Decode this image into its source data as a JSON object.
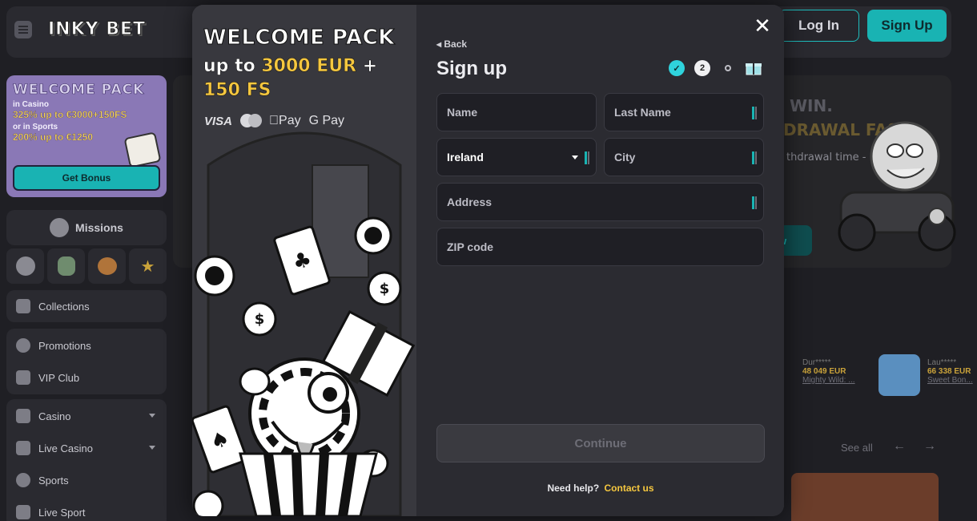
{
  "header": {
    "logo_text": "INKY BET",
    "login_label": "Log In",
    "signup_label": "Sign Up"
  },
  "sidebar": {
    "promo": {
      "title": "WELCOME PACK",
      "casino_label": "in Casino",
      "casino_offer": "325% up to €3000+150FS",
      "sports_label": "or in Sports",
      "sports_offer": "200% up to €1250",
      "button": "Get Bonus"
    },
    "missions_label": "Missions",
    "items": [
      {
        "label": "Collections",
        "icon": "bookmark-icon"
      },
      {
        "label": "Promotions",
        "icon": "percent-icon"
      },
      {
        "label": "VIP Club",
        "icon": "crown-icon"
      },
      {
        "label": "Casino",
        "icon": "casino-chip-icon"
      },
      {
        "label": "Live Casino",
        "icon": "dice-icon"
      },
      {
        "label": "Sports",
        "icon": "ball-icon"
      },
      {
        "label": "Live Sport",
        "icon": "camera-icon"
      }
    ]
  },
  "background": {
    "banner_line1": "WIN.",
    "banner_line2": "DRAWAL FAST",
    "banner_text": "thdrawal time -",
    "cta_fragment": "ow",
    "winners": [
      {
        "user": "Dur*****",
        "amount": "48 049 EUR",
        "game": "Mighty Wild: ..."
      },
      {
        "user": "Lau*****",
        "amount": "66 338 EUR",
        "game": "Sweet Bon..."
      }
    ],
    "see_all": "See all"
  },
  "modal": {
    "left": {
      "title": "WELCOME PACK",
      "subtitle_prefix": "up to",
      "subtitle_amount": "3000 EUR",
      "subtitle_plus": "+",
      "subtitle_fs": "150 FS",
      "payments": {
        "visa": "VISA",
        "mastercard": "mobilecard",
        "apple": "Pay",
        "google": "G Pay"
      }
    },
    "back_label": "Back",
    "title": "Sign up",
    "steps": {
      "current": "2"
    },
    "fields": {
      "name": {
        "placeholder": "Name",
        "value": ""
      },
      "last_name": {
        "placeholder": "Last Name",
        "value": ""
      },
      "country": {
        "value": "Ireland"
      },
      "city": {
        "placeholder": "City",
        "value": ""
      },
      "address": {
        "placeholder": "Address",
        "value": ""
      },
      "zip": {
        "placeholder": "ZIP code",
        "value": ""
      }
    },
    "continue_label": "Continue",
    "help_text": "Need help?",
    "contact_label": "Contact us"
  },
  "colors": {
    "accent": "#19b3b3",
    "highlight": "#f5c73f",
    "modal_bg": "#2b2b31",
    "field_bg": "#1f1f25"
  }
}
